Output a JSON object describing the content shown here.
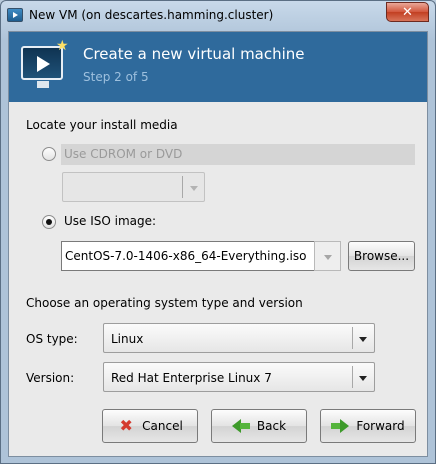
{
  "window": {
    "title": "New VM (on descartes.hamming.cluster)",
    "close_label": "✕"
  },
  "header": {
    "title": "Create a new virtual machine",
    "step": "Step 2 of 5"
  },
  "install_media": {
    "section_label": "Locate your install media",
    "cdrom_label": "Use CDROM or DVD",
    "cdrom_selected": false,
    "cdrom_combo_value": "",
    "iso_label": "Use ISO image:",
    "iso_selected": true,
    "iso_path": "CentOS-7.0-1406-x86_64-Everything.iso",
    "browse_label": "Browse..."
  },
  "os": {
    "section_label": "Choose an operating system type and version",
    "type_label": "OS type:",
    "type_value": "Linux",
    "version_label": "Version:",
    "version_value": "Red Hat Enterprise Linux 7"
  },
  "buttons": {
    "cancel": "Cancel",
    "back": "Back",
    "forward": "Forward"
  },
  "colors": {
    "banner": "#2f6a9c",
    "banner_subtitle": "#9ec0de",
    "close_button": "#c23f22"
  }
}
